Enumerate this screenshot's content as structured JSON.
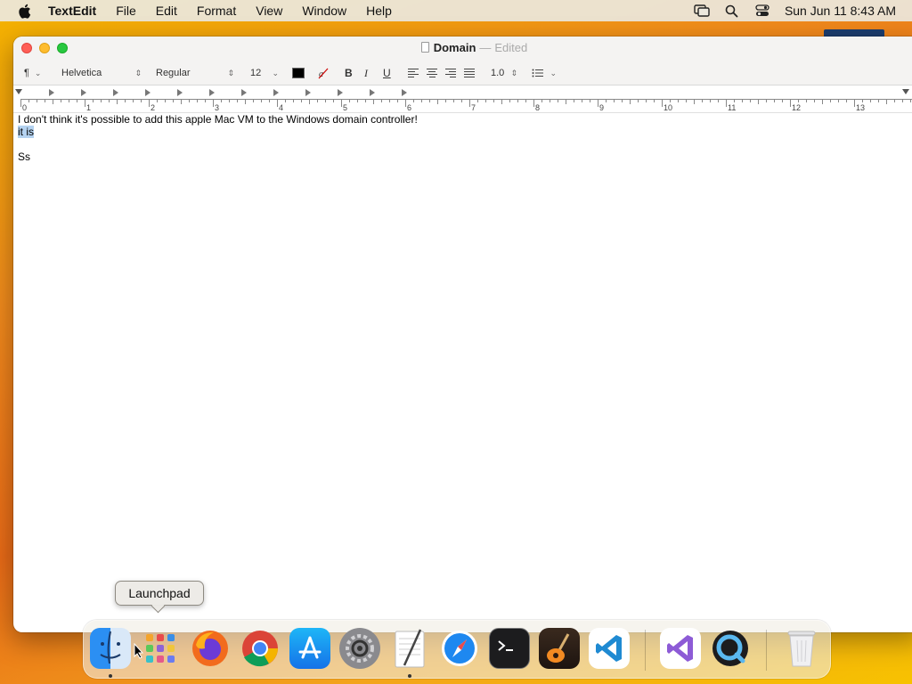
{
  "menubar": {
    "apple_icon": "apple-logo-icon",
    "app_name": "TextEdit",
    "items": [
      "File",
      "Edit",
      "Format",
      "View",
      "Window",
      "Help"
    ],
    "status_icons": [
      "screen-mirroring-icon",
      "spotlight-search-icon",
      "control-center-icon"
    ],
    "clock": "Sun Jun 11  8:43 AM"
  },
  "window": {
    "title": "Domain",
    "title_separator": "—",
    "status": "Edited",
    "toolbar": {
      "paragraph_style": "¶",
      "font_family": "Helvetica",
      "font_style": "Regular",
      "font_size": "12",
      "text_color": "#000000",
      "bold": "B",
      "italic": "I",
      "underline": "U",
      "line_spacing": "1.0",
      "list_icon": "bullet-list-icon"
    },
    "ruler": {
      "numbers": [
        "0",
        "1",
        "2",
        "3",
        "4",
        "5",
        "6",
        "7",
        "8",
        "9",
        "10",
        "11",
        "12",
        "13"
      ]
    },
    "document": {
      "lines": [
        "I don't think it's possible to add this apple Mac VM to the Windows domain controller!",
        "it is",
        "",
        "Ss"
      ],
      "selected_text": "it is"
    }
  },
  "dock": {
    "tooltip": "Launchpad",
    "apps": [
      {
        "name": "Finder",
        "icon": "finder-icon",
        "running": true
      },
      {
        "name": "Launchpad",
        "icon": "launchpad-icon",
        "running": false
      },
      {
        "name": "Firefox",
        "icon": "firefox-icon",
        "running": false
      },
      {
        "name": "Google Chrome",
        "icon": "chrome-icon",
        "running": false
      },
      {
        "name": "App Store",
        "icon": "app-store-icon",
        "running": false
      },
      {
        "name": "System Settings",
        "icon": "system-settings-icon",
        "running": false
      },
      {
        "name": "TextEdit",
        "icon": "textedit-icon",
        "running": true
      },
      {
        "name": "Safari",
        "icon": "safari-icon",
        "running": false
      },
      {
        "name": "Terminal",
        "icon": "terminal-icon",
        "running": false
      },
      {
        "name": "GarageBand",
        "icon": "garageband-icon",
        "running": false
      },
      {
        "name": "Visual Studio Code",
        "icon": "vscode-icon",
        "running": false
      },
      {
        "name": "Visual Studio",
        "icon": "visual-studio-icon",
        "running": false
      },
      {
        "name": "QuickTime Player",
        "icon": "quicktime-icon",
        "running": false
      },
      {
        "name": "Trash",
        "icon": "trash-icon",
        "running": false
      }
    ]
  },
  "colors": {
    "close": "#ff5f57",
    "minimize": "#febc2e",
    "maximize": "#28c840",
    "selection": "#b4d2f0"
  }
}
